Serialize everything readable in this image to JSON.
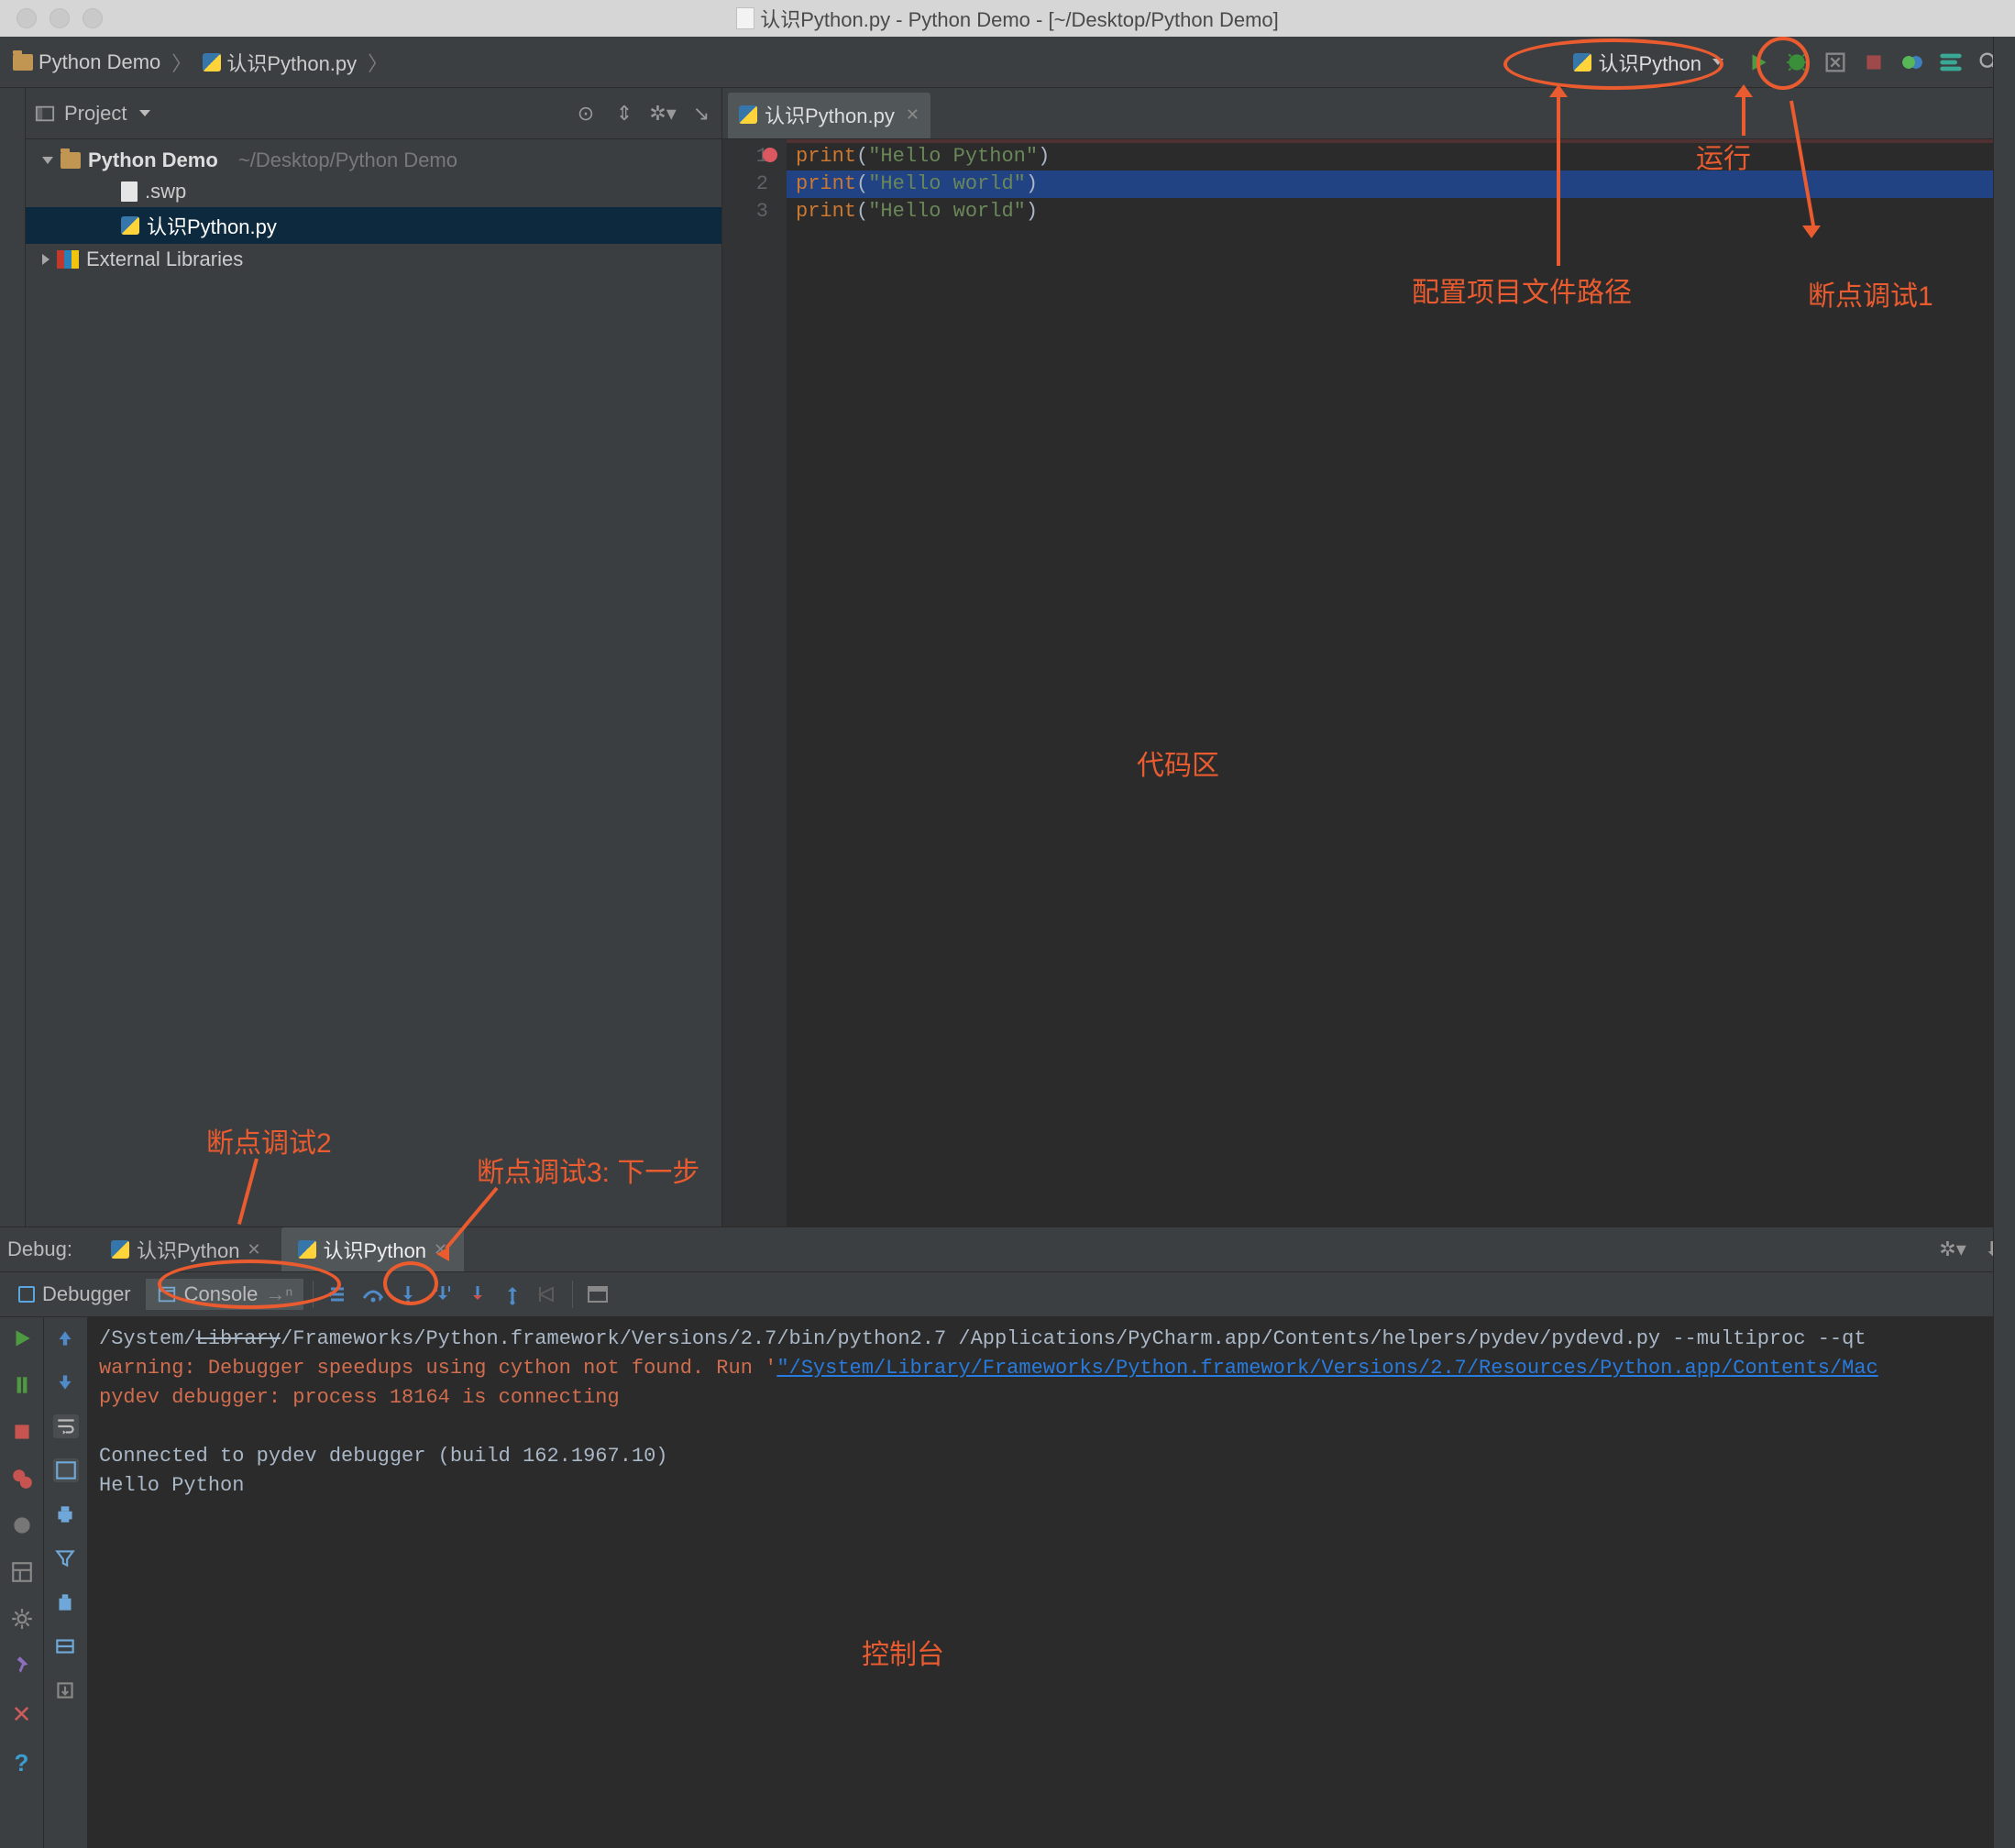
{
  "window": {
    "title": "认识Python.py - Python Demo - [~/Desktop/Python Demo]"
  },
  "breadcrumb": {
    "project": "Python Demo",
    "file": "认识Python.py"
  },
  "toolbar": {
    "run_config": "认识Python"
  },
  "project_panel": {
    "title": "Project",
    "root_name": "Python Demo",
    "root_path": "~/Desktop/Python Demo",
    "file_swp": ".swp",
    "file_py": "认识Python.py",
    "external": "External Libraries"
  },
  "editor": {
    "tab": "认识Python.py",
    "lines": [
      {
        "n": "1",
        "kw": "print",
        "str": "\"Hello Python\""
      },
      {
        "n": "2",
        "kw": "print",
        "str": "\"Hello world\""
      },
      {
        "n": "3",
        "kw": "print",
        "str": "\"Hello world\""
      }
    ]
  },
  "debug": {
    "label": "Debug:",
    "tab1": "认识Python",
    "tab2": "认识Python",
    "sub_debugger": "Debugger",
    "sub_console": "Console",
    "console": {
      "l1a": "/System/",
      "l1strike": "Library",
      "l1b": "/Frameworks/Python.framework/Versions/2.7/bin/python2.7 /Applications/PyCharm.app/Contents/helpers/pydev/pydevd.py --multiproc --qt",
      "l2a": "warning: Debugger speedups using cython not found. Run '",
      "l2link": "\"/System/Library/Frameworks/Python.framework/Versions/2.7/Resources/Python.app/Contents/Mac",
      "l3": "pydev debugger: process 18164 is connecting",
      "l4": "",
      "l5": "Connected to pydev debugger (build 162.1967.10)",
      "l6": "Hello Python"
    }
  },
  "annotations": {
    "run": "运行",
    "config": "配置项目文件路径",
    "bp1": "断点调试1",
    "code": "代码区",
    "bp2": "断点调试2",
    "bp3": "断点调试3: 下一步",
    "console": "控制台"
  }
}
